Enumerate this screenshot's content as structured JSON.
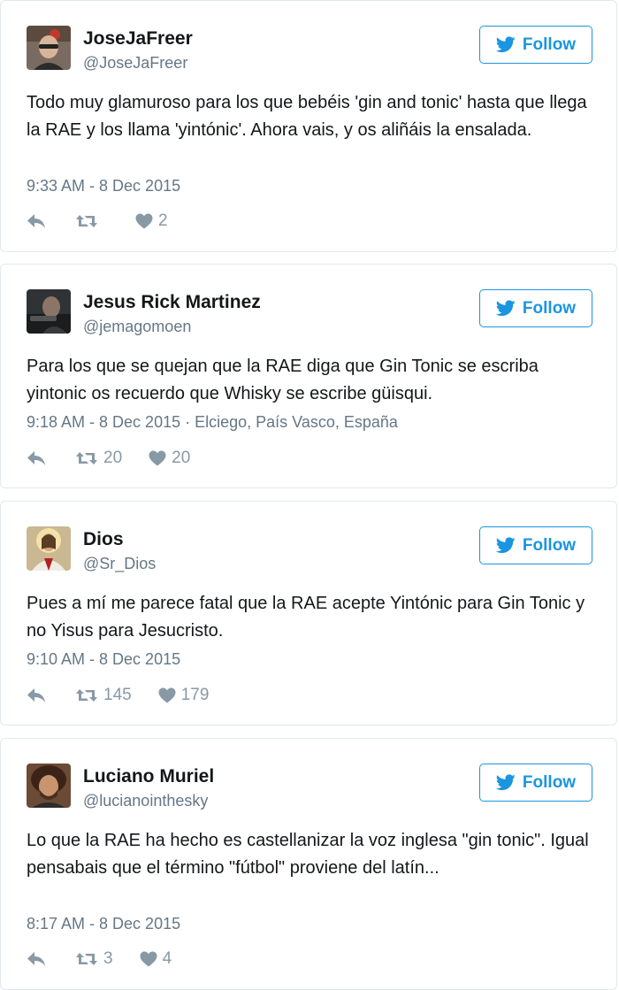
{
  "tweets": [
    {
      "name": "JoseJaFreer",
      "handle": "@JoseJaFreer",
      "follow_label": "Follow",
      "text": "Todo muy glamuroso para los que bebéis 'gin and tonic' hasta que llega la RAE y los llama 'yintónic'. Ahora vais, y os aliñáis la ensalada.",
      "meta": "9:33 AM - 8 Dec 2015",
      "retweets": "",
      "likes": "2"
    },
    {
      "name": "Jesus Rick Martinez",
      "handle": "@jemagomoen",
      "follow_label": "Follow",
      "text": "Para los que se quejan que la RAE diga que Gin Tonic se escriba yintonic os recuerdo que Whisky se escribe güisqui.",
      "meta": "9:18 AM - 8 Dec 2015 · Elciego, País Vasco, España",
      "retweets": "20",
      "likes": "20"
    },
    {
      "name": "Dios",
      "handle": "@Sr_Dios",
      "follow_label": "Follow",
      "text": "Pues a mí me parece fatal que la RAE acepte Yintónic para Gin Tonic y no Yisus para Jesucristo.",
      "meta": "9:10 AM - 8 Dec 2015",
      "retweets": "145",
      "likes": "179"
    },
    {
      "name": "Luciano Muriel",
      "handle": "@lucianointhesky",
      "follow_label": "Follow",
      "text": "Lo que la RAE ha hecho es castellanizar la voz inglesa \"gin tonic\". Igual pensabais que el término \"fútbol\" proviene del latín...",
      "meta": "8:17 AM - 8 Dec 2015",
      "retweets": "3",
      "likes": "4"
    }
  ],
  "colors": {
    "accent": "#1b95e0",
    "text": "#14171a",
    "secondary": "#657786",
    "icon": "#8899a6",
    "border": "#e1e8ed"
  },
  "icons": {
    "follow": "twitter-bird-icon",
    "reply": "reply-icon",
    "retweet": "retweet-icon",
    "like": "heart-icon"
  }
}
